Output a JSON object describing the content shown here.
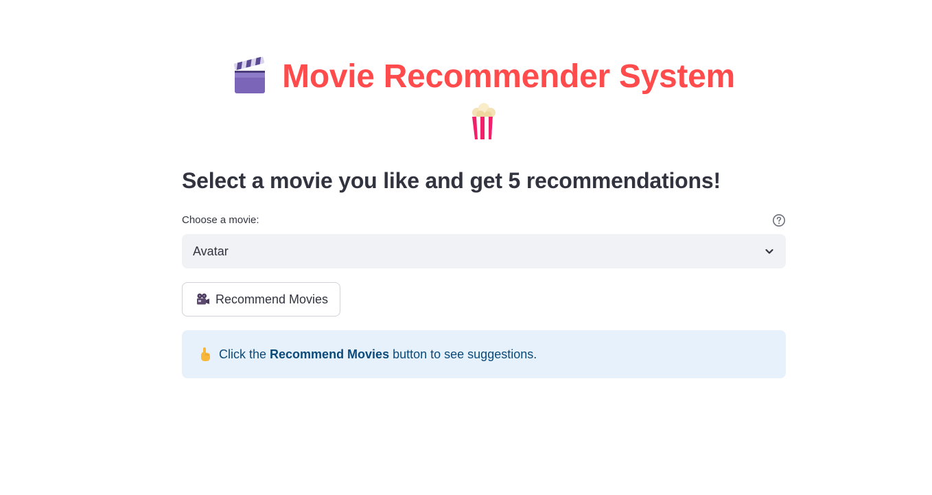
{
  "header": {
    "title": "Movie Recommender System",
    "title_icon_left": "clapper-board-icon",
    "title_icon_below": "popcorn-icon",
    "title_color": "#ff4b4b"
  },
  "subheader": "Select a movie you like and get 5 recommendations!",
  "movie_select": {
    "label": "Choose a movie:",
    "selected": "Avatar",
    "help_icon": "question-circle-icon"
  },
  "recommend_button": {
    "icon": "movie-camera-icon",
    "label": "Recommend Movies"
  },
  "info_box": {
    "icon": "pointing-hand-icon",
    "text_before": "Click the ",
    "text_bold": "Recommend Movies",
    "text_after": " button to see suggestions.",
    "background": "#e6f1fb"
  }
}
